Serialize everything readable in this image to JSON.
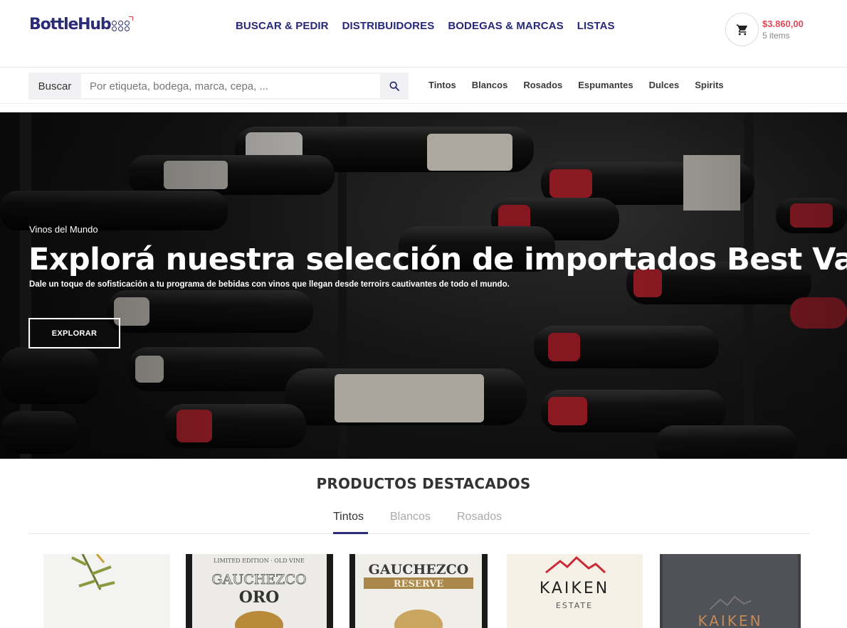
{
  "brand": {
    "name": "BottleHub"
  },
  "nav": {
    "items": [
      "BUSCAR & PEDIR",
      "DISTRIBUIDORES",
      "BODEGAS & MARCAS",
      "LISTAS"
    ]
  },
  "cart": {
    "total": "$3.860,00",
    "items": "5 items"
  },
  "search": {
    "label": "Buscar",
    "placeholder": "Por etiqueta, bodega, marca, cepa, ..."
  },
  "categories": [
    "Tintos",
    "Blancos",
    "Rosados",
    "Espumantes",
    "Dulces",
    "Spirits"
  ],
  "hero": {
    "kicker": "Vinos del Mundo",
    "title": "Explorá nuestra selección de importados Best Value",
    "subtitle": "Dale un toque de sofisticación a tu programa de bebidas con vinos que llegan desde terroirs cautivantes de todo el mundo.",
    "cta": "EXPLORAR"
  },
  "featured": {
    "title": "PRODUCTOS DESTACADOS",
    "tabs": [
      "Tintos",
      "Blancos",
      "Rosados"
    ],
    "active_tab": "Tintos",
    "products": [
      {
        "label": ""
      },
      {
        "label_top": "LIMITED EDITION · OLD VINE",
        "label_brand": "GAUCHEZCO",
        "label_line": "ORO"
      },
      {
        "label_brand": "GAUCHEZCO",
        "label_line": "RESERVE"
      },
      {
        "label_brand": "KAIKEN",
        "label_line": "ESTATE"
      },
      {
        "label_brand": "KAIKEN"
      }
    ]
  },
  "colors": {
    "brand_navy": "#2a2c77",
    "cart_red": "#e0495a"
  },
  "icons": {
    "cart": "cart-icon",
    "search": "search-icon"
  }
}
